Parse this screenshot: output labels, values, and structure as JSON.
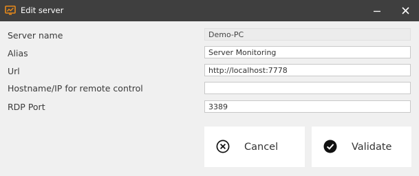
{
  "window": {
    "title": "Edit server",
    "app_icon": "monitor-chart-icon",
    "minimize_icon": "minimize-icon",
    "close_icon": "close-icon",
    "accent_color": "#e88a1a",
    "titlebar_color": "#3f3f3f"
  },
  "form": {
    "server_name": {
      "label": "Server name",
      "value": "Demo-PC",
      "readonly": true
    },
    "alias": {
      "label": "Alias",
      "value": "Server Monitoring"
    },
    "url": {
      "label": "Url",
      "value": "http://localhost:7778"
    },
    "hostname": {
      "label": "Hostname/IP for remote control",
      "value": ""
    },
    "rdp_port": {
      "label": "RDP Port",
      "value": "3389"
    }
  },
  "buttons": {
    "cancel": {
      "label": "Cancel",
      "icon": "cancel-circle-icon"
    },
    "validate": {
      "label": "Validate",
      "icon": "check-circle-icon"
    }
  }
}
